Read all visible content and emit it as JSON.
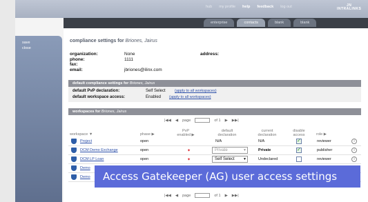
{
  "toplinks": [
    "hub",
    "my profile",
    "help",
    "feedback",
    "log out"
  ],
  "logo": {
    "line1": "JN",
    "line2": "INTRALINKS"
  },
  "tabs": [
    "enterprise",
    "contacts",
    "blank",
    "blank"
  ],
  "left_menu": [
    "save",
    "close"
  ],
  "heading": {
    "prefix": "compliance settings for",
    "name": "Briones, Jairus"
  },
  "contact": {
    "organization_label": "organization:",
    "organization": "None",
    "phone_label": "phone:",
    "phone": "1111",
    "fax_label": "fax:",
    "fax": "",
    "email_label": "email:",
    "email": "jbriones@ilinx.com",
    "address_label": "address:"
  },
  "default_bar": {
    "prefix": "default compliance settings for",
    "name": "Briones, Jairus"
  },
  "defaults": {
    "pvp_label": "default PvP declaration:",
    "pvp_value": "Self Select",
    "pvp_link": "(apply to all workspaces)",
    "access_label": "default workspace access:",
    "access_value": "Enabled",
    "access_link": "(apply to all workspaces)"
  },
  "ws_bar": {
    "prefix": "workspaces for",
    "name": "Briones, Jairus"
  },
  "pager": {
    "first": "|◀◀",
    "prev": "◀",
    "page_label": "page",
    "of_label": "of 1",
    "next": "▶",
    "last": "▶▶|"
  },
  "columns": {
    "workspace": "workspace ▼",
    "phase": "phase ▶",
    "pvp_enabled": "PvP enabled ▶",
    "default_declaration": "default declaration",
    "current_declaration": "current declaration",
    "disable_access": "disable access",
    "role": "role ▶"
  },
  "rows": [
    {
      "name": "Project",
      "phase": "open",
      "default": "N/A",
      "current": "N/A",
      "disabled": true,
      "role": "reviewer"
    },
    {
      "name": "DCM Demo Exchange",
      "phase": "open",
      "default": "Private",
      "current": "Private",
      "disabled": true,
      "role": "publisher"
    },
    {
      "name": "DCM LP Loan",
      "phase": "open",
      "default": "Self Select",
      "current": "Undeclared",
      "disabled": false,
      "role": "reviewer"
    },
    {
      "name": "Demo",
      "phase": "",
      "default": "",
      "current": "",
      "disabled": false,
      "role": ""
    },
    {
      "name": "Demo",
      "phase": "",
      "default": "",
      "current": "",
      "disabled": false,
      "role": ""
    }
  ],
  "caption": "Access Gatekeeper (AG) user access settings"
}
